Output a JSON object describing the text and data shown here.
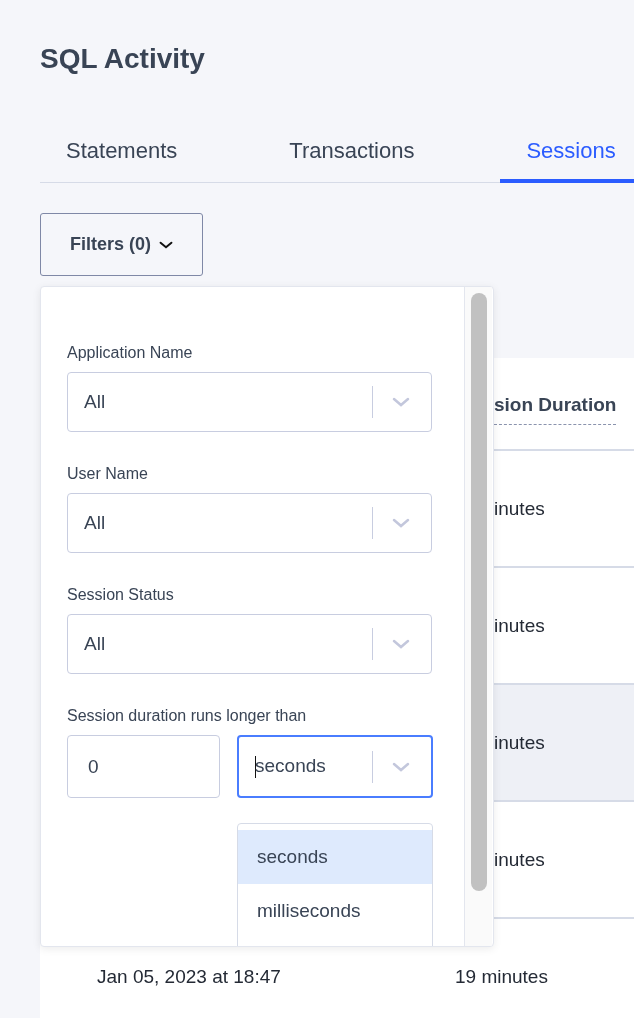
{
  "page": {
    "title": "SQL Activity"
  },
  "tabs": [
    {
      "label": "Statements",
      "selected": false
    },
    {
      "label": "Transactions",
      "selected": false
    },
    {
      "label": "Sessions",
      "selected": true
    }
  ],
  "filters_button": {
    "label": "Filters (0)",
    "expanded": true
  },
  "filter_panel": {
    "selects": [
      {
        "label": "Application Name",
        "value": "All"
      },
      {
        "label": "User Name",
        "value": "All"
      },
      {
        "label": "Session Status",
        "value": "All"
      }
    ],
    "duration": {
      "label": "Session duration runs longer than",
      "value": "0",
      "unit": "seconds",
      "focused": true
    },
    "unit_options": [
      {
        "label": "seconds",
        "selected": true
      },
      {
        "label": "milliseconds",
        "selected": false
      }
    ]
  },
  "table": {
    "columns": [
      "sion Duration"
    ],
    "rows": [
      {
        "duration": "inutes",
        "highlighted": false
      },
      {
        "duration": "inutes",
        "highlighted": false
      },
      {
        "duration": "inutes",
        "highlighted": true
      },
      {
        "duration": "inutes",
        "highlighted": false
      },
      {
        "start": "Jan 05, 2023 at 18:47",
        "duration": "19 minutes",
        "highlighted": false
      }
    ]
  }
}
